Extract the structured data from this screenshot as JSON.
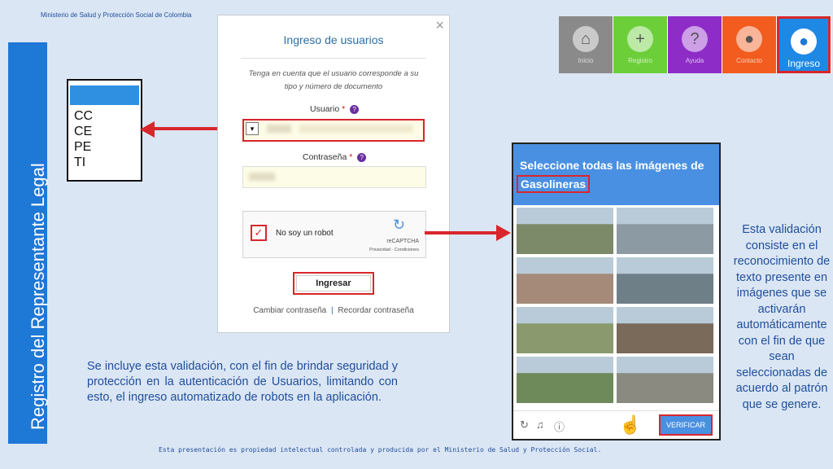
{
  "header": {
    "ministry": "Ministerio de Salud y Protección Social de Colombia"
  },
  "footer": {
    "notice": "Esta presentación es propiedad intelectual controlada y producida por el Ministerio de Salud y Protección Social."
  },
  "sidebar": {
    "title": "Registro del Representante Legal"
  },
  "doc_types": {
    "options": [
      "CC",
      "CE",
      "PE",
      "TI"
    ]
  },
  "login": {
    "title": "Ingreso de usuarios",
    "close": "×",
    "note": "Tenga en cuenta que el usuario corresponde a su tipo y número de documento",
    "user_label": "Usuario",
    "password_label": "Contraseña",
    "required_mark": "*",
    "help_mark": "?",
    "select_arrow": "▾",
    "recaptcha_label": "No soy un robot",
    "recaptcha_check": "✓",
    "recaptcha_brand": "reCAPTCHA",
    "recaptcha_terms": "Privacidad - Condiciones",
    "submit": "Ingresar",
    "change_password": "Cambiar contraseña",
    "link_separator": "|",
    "recover_password": "Recordar contraseña"
  },
  "nav": {
    "items": [
      {
        "label": "Inicio",
        "icon": "home-icon",
        "glyph": "⌂",
        "color": "#8a8a8a"
      },
      {
        "label": "Registro",
        "icon": "plus-icon",
        "glyph": "+",
        "color": "#6ccf3a"
      },
      {
        "label": "Ayuda",
        "icon": "question-icon",
        "glyph": "?",
        "color": "#8e2cc8"
      },
      {
        "label": "Contacto",
        "icon": "location-pin-icon",
        "glyph": "●",
        "color": "#f25c1e"
      },
      {
        "label": "Ingreso",
        "icon": "user-icon",
        "glyph": "●",
        "color": "#1e88e5"
      }
    ]
  },
  "captcha_example": {
    "title_line1": "Seleccione todas las imágenes de",
    "title_line2": "Gasolineras",
    "verify": "VERIFICAR",
    "reload_icon": "↻",
    "audio_icon": "♫",
    "info_icon": "ⓘ",
    "hand_icon": "☝",
    "tile_colors": [
      "#7d8a6a",
      "#8c9aa3",
      "#a58a7a",
      "#6f7f88",
      "#8a9a6e",
      "#7a6a5a",
      "#6e8a5a",
      "#8a8a80"
    ]
  },
  "descriptions": {
    "left": "Se incluye esta validación, con el fin de brindar seguridad y protección en la autenticación de Usuarios, limitando con esto, el ingreso automatizado de robots en la aplicación.",
    "right": "Esta validación consiste en el reconocimiento de texto presente en imágenes que se activarán automáticamente con el fin de que sean seleccionadas de acuerdo al patrón que se genere."
  },
  "colors": {
    "accent_red": "#d8262c",
    "brand_blue": "#1e78d6",
    "text_blue": "#1f4e9b"
  }
}
